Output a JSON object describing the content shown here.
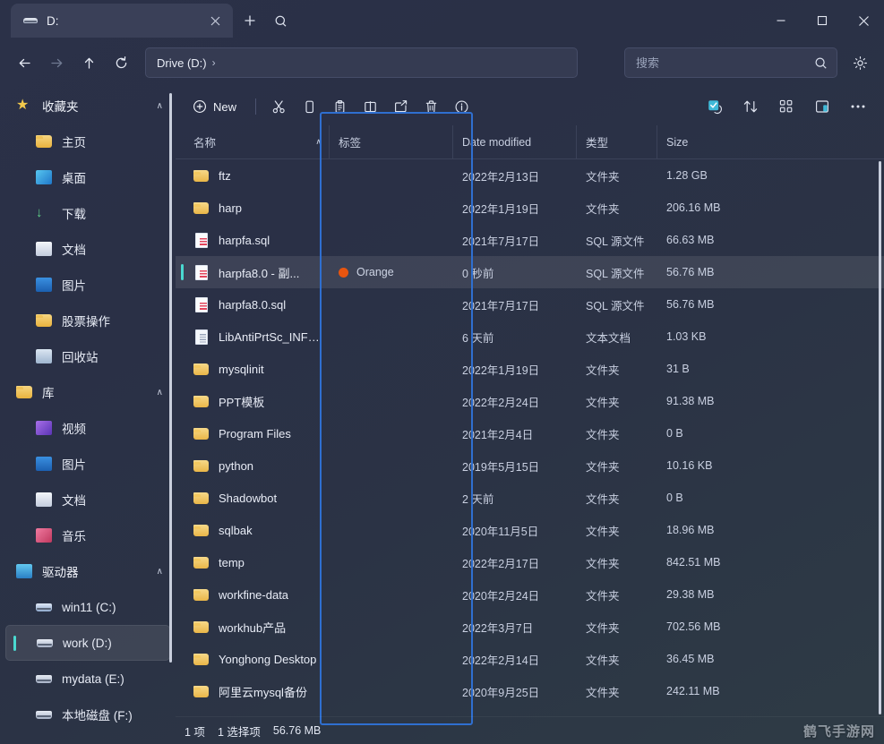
{
  "window": {
    "tab_title": "D:",
    "minimize_label": "最小化",
    "maximize_label": "最大化",
    "close_label": "关闭"
  },
  "nav": {
    "back_label": "返回",
    "forward_label": "前进",
    "up_label": "向上",
    "refresh_label": "刷新",
    "breadcrumb": "Drive (D:)",
    "breadcrumb_sep": "›"
  },
  "search": {
    "placeholder": "搜索",
    "value": ""
  },
  "toolbar": {
    "new_label": "New",
    "cut_label": "剪切",
    "copy_label": "复制",
    "paste_label": "粘贴",
    "rename_label": "重命名",
    "share_label": "共享",
    "delete_label": "删除",
    "info_label": "属性",
    "select_label": "全选",
    "sort_label": "排序",
    "view_label": "查看",
    "layout_label": "布局",
    "more_label": "更多"
  },
  "sidebar": {
    "groups": [
      {
        "label": "收藏夹",
        "icon": "star-icon",
        "items": [
          {
            "label": "主页",
            "icon": "folder-icon"
          },
          {
            "label": "桌面",
            "icon": "desktop-icon"
          },
          {
            "label": "下载",
            "icon": "download-icon"
          },
          {
            "label": "文档",
            "icon": "document-icon"
          },
          {
            "label": "图片",
            "icon": "picture-icon"
          },
          {
            "label": "股票操作",
            "icon": "folder-icon"
          },
          {
            "label": "回收站",
            "icon": "recycle-bin-icon"
          }
        ]
      },
      {
        "label": "库",
        "icon": "folder-icon",
        "items": [
          {
            "label": "视频",
            "icon": "video-icon"
          },
          {
            "label": "图片",
            "icon": "picture-icon"
          },
          {
            "label": "文档",
            "icon": "document-icon"
          },
          {
            "label": "音乐",
            "icon": "music-icon"
          }
        ]
      },
      {
        "label": "驱动器",
        "icon": "monitor-icon",
        "items": [
          {
            "label": "win11 (C:)",
            "icon": "hdd-win-icon",
            "selected": false
          },
          {
            "label": "work (D:)",
            "icon": "hdd-icon",
            "selected": true
          },
          {
            "label": "mydata (E:)",
            "icon": "hdd-icon",
            "selected": false
          },
          {
            "label": "本地磁盘 (F:)",
            "icon": "hdd-icon",
            "selected": false
          }
        ]
      }
    ]
  },
  "list": {
    "columns": [
      {
        "label": "名称",
        "sort": "∧"
      },
      {
        "label": "标签",
        "sort": ""
      },
      {
        "label": "Date modified",
        "sort": ""
      },
      {
        "label": "类型",
        "sort": ""
      },
      {
        "label": "Size",
        "sort": ""
      }
    ],
    "rows": [
      {
        "name": "ftz",
        "icon": "folder-icon",
        "tag": "",
        "tag_color": "",
        "date": "2022年2月13日",
        "type": "文件夹",
        "size": "1.28 GB",
        "selected": false
      },
      {
        "name": "harp",
        "icon": "folder-icon",
        "tag": "",
        "tag_color": "",
        "date": "2022年1月19日",
        "type": "文件夹",
        "size": "206.16 MB",
        "selected": false
      },
      {
        "name": "harpfa.sql",
        "icon": "sql-file-icon",
        "tag": "",
        "tag_color": "",
        "date": "2021年7月17日",
        "type": "SQL 源文件",
        "size": "66.63 MB",
        "selected": false
      },
      {
        "name": "harpfa8.0 - 副...",
        "icon": "sql-file-icon",
        "tag": "Orange",
        "tag_color": "#e8550f",
        "date": "0 秒前",
        "type": "SQL 源文件",
        "size": "56.76 MB",
        "selected": true
      },
      {
        "name": "harpfa8.0.sql",
        "icon": "sql-file-icon",
        "tag": "",
        "tag_color": "",
        "date": "2021年7月17日",
        "type": "SQL 源文件",
        "size": "56.76 MB",
        "selected": false
      },
      {
        "name": "LibAntiPrtSc_INFO...",
        "icon": "text-file-icon",
        "tag": "",
        "tag_color": "",
        "date": "6 天前",
        "type": "文本文档",
        "size": "1.03 KB",
        "selected": false
      },
      {
        "name": "mysqlinit",
        "icon": "folder-icon",
        "tag": "",
        "tag_color": "",
        "date": "2022年1月19日",
        "type": "文件夹",
        "size": "31 B",
        "selected": false
      },
      {
        "name": "PPT模板",
        "icon": "folder-icon",
        "tag": "",
        "tag_color": "",
        "date": "2022年2月24日",
        "type": "文件夹",
        "size": "91.38 MB",
        "selected": false
      },
      {
        "name": "Program Files",
        "icon": "folder-icon",
        "tag": "",
        "tag_color": "",
        "date": "2021年2月4日",
        "type": "文件夹",
        "size": "0 B",
        "selected": false
      },
      {
        "name": "python",
        "icon": "folder-icon",
        "tag": "",
        "tag_color": "",
        "date": "2019年5月15日",
        "type": "文件夹",
        "size": "10.16 KB",
        "selected": false
      },
      {
        "name": "Shadowbot",
        "icon": "folder-icon",
        "tag": "",
        "tag_color": "",
        "date": "2 天前",
        "type": "文件夹",
        "size": "0 B",
        "selected": false
      },
      {
        "name": "sqlbak",
        "icon": "folder-icon",
        "tag": "",
        "tag_color": "",
        "date": "2020年11月5日",
        "type": "文件夹",
        "size": "18.96 MB",
        "selected": false
      },
      {
        "name": "temp",
        "icon": "folder-icon",
        "tag": "",
        "tag_color": "",
        "date": "2022年2月17日",
        "type": "文件夹",
        "size": "842.51 MB",
        "selected": false
      },
      {
        "name": "workfine-data",
        "icon": "folder-icon",
        "tag": "",
        "tag_color": "",
        "date": "2020年2月24日",
        "type": "文件夹",
        "size": "29.38 MB",
        "selected": false
      },
      {
        "name": "workhub产品",
        "icon": "folder-icon",
        "tag": "",
        "tag_color": "",
        "date": "2022年3月7日",
        "type": "文件夹",
        "size": "702.56 MB",
        "selected": false
      },
      {
        "name": "Yonghong Desktop",
        "icon": "folder-icon",
        "tag": "",
        "tag_color": "",
        "date": "2022年2月14日",
        "type": "文件夹",
        "size": "36.45 MB",
        "selected": false
      },
      {
        "name": "阿里云mysql备份",
        "icon": "folder-icon",
        "tag": "",
        "tag_color": "",
        "date": "2020年9月25日",
        "type": "文件夹",
        "size": "242.11 MB",
        "selected": false
      }
    ]
  },
  "status": {
    "item_count": "1 项",
    "selected_count": "1 选择项",
    "selected_size": "56.76 MB"
  },
  "overlay": {
    "highlight_color": "#2f6fd0"
  },
  "watermark": "鹤飞手游网"
}
